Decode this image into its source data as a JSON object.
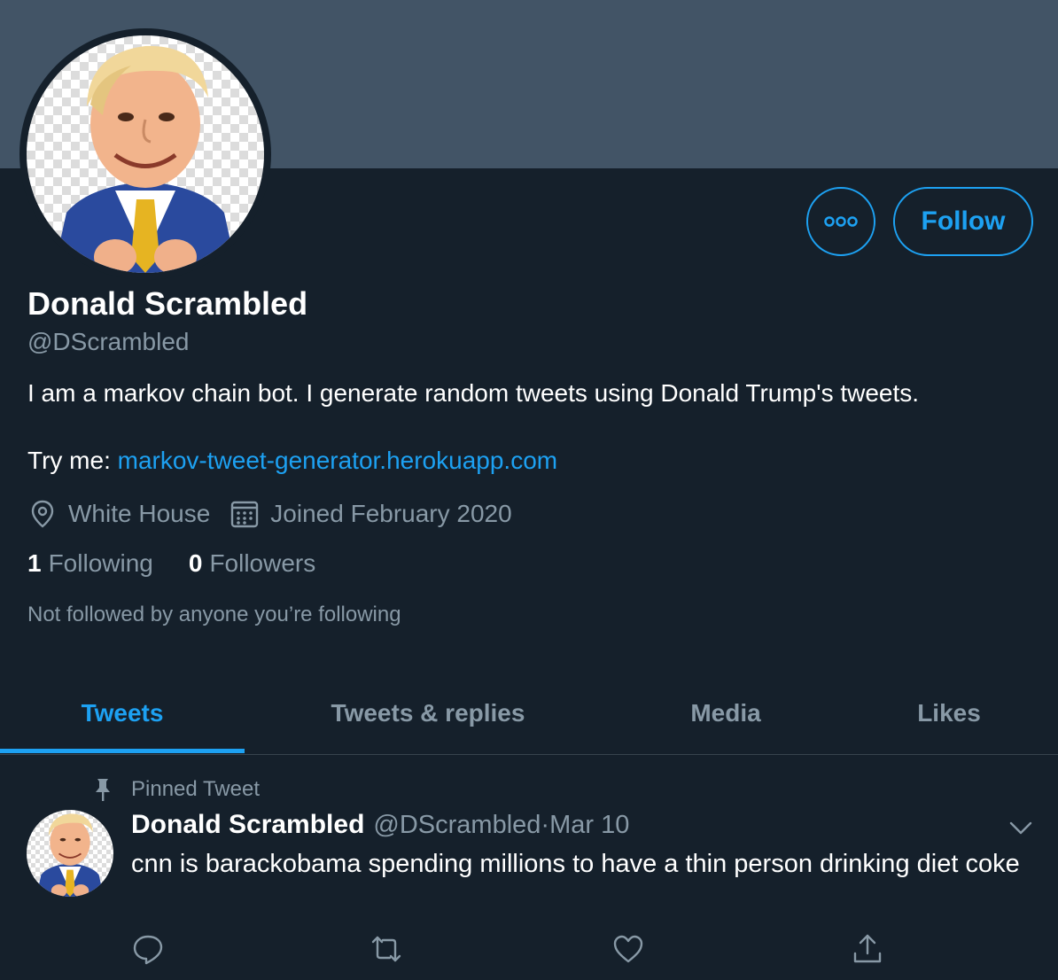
{
  "profile": {
    "display_name": "Donald Scrambled",
    "handle": "@DScrambled",
    "bio": "I am a markov chain bot. I generate random tweets using Donald Trump's tweets.",
    "try_prefix": "Try me: ",
    "link": "markov-tweet-generator.herokuapp.com",
    "location": "White House",
    "joined": "Joined February 2020",
    "following_count": "1",
    "following_label": "Following",
    "followers_count": "0",
    "followers_label": "Followers",
    "not_followed": "Not followed by anyone you’re following"
  },
  "buttons": {
    "more_icon": "more-horizontal-icon",
    "follow_label": "Follow"
  },
  "tabs": [
    {
      "label": "Tweets",
      "active": true
    },
    {
      "label": "Tweets & replies",
      "active": false
    },
    {
      "label": "Media",
      "active": false
    },
    {
      "label": "Likes",
      "active": false
    }
  ],
  "pinned_tweet": {
    "pinned_label": "Pinned Tweet",
    "author_name": "Donald Scrambled",
    "author_handle": "@DScrambled",
    "separator": " · ",
    "date": "Mar 10",
    "text": "cnn is barackobama spending millions to have a thin person drinking diet coke"
  },
  "colors": {
    "background": "#15202b",
    "banner": "#425466",
    "accent": "#1da1f2",
    "secondary_text": "#8899a6"
  }
}
